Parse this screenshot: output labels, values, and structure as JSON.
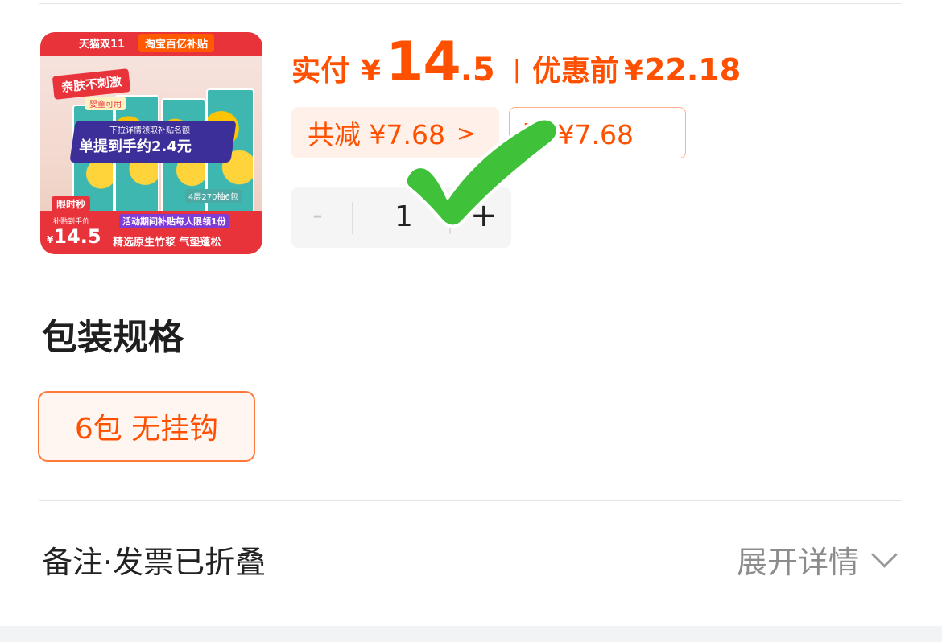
{
  "product_image": {
    "badge_tmall": "天猫双11",
    "badge_taobao": "淘宝百亿补贴",
    "slogan": "亲肤不刺激",
    "slogan_sub": "婴童可用",
    "banner_small": "下拉详情领取补贴名额",
    "banner_big": "单提到手约2.4元",
    "spec_tag": "4层270抽6包",
    "flash_tag": "限时秒",
    "price_label": "补贴到手价",
    "price_currency": "¥",
    "price_value": "14.5",
    "activity": "活动期间补贴每人限领1份",
    "feature": "精选原生竹浆 气垫蓬松"
  },
  "price": {
    "pay_label": "实付",
    "currency": "¥",
    "pay_int": "14",
    "pay_dec": ".5",
    "separator": "|",
    "orig_label": "优惠前",
    "orig_value": "22.18"
  },
  "discounts": {
    "total_label": "共减 ¥7.68",
    "total_chevron": ">",
    "subsidy_label": "贴 ¥7.68"
  },
  "quantity": {
    "minus": "-",
    "value": "1",
    "plus": "+"
  },
  "spec": {
    "title": "包装规格",
    "option": "6包 无挂钩"
  },
  "note": {
    "label": "备注·发票已折叠",
    "expand": "展开详情"
  },
  "colors": {
    "accent": "#ff5000",
    "checkmark": "#3fc13a"
  }
}
